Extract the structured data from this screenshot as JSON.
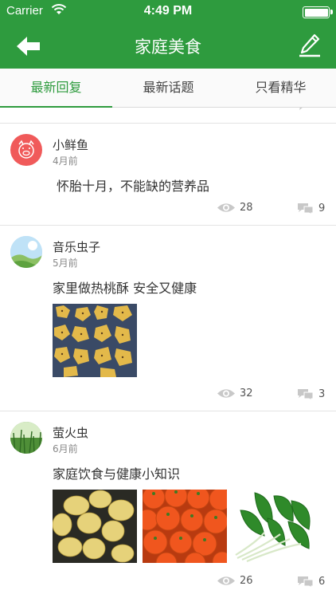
{
  "status": {
    "carrier": "Carrier",
    "time": "4:49 PM"
  },
  "nav": {
    "title": "家庭美食"
  },
  "tabs": [
    {
      "label": "最新回复",
      "active": true
    },
    {
      "label": "最新话题",
      "active": false
    },
    {
      "label": "只看精华",
      "active": false
    }
  ],
  "posts": [
    {
      "user": "小鲜鱼",
      "time": "4月前",
      "title": "怀胎十月，不能缺的营养品",
      "views": "28",
      "comments": "9"
    },
    {
      "user": "音乐虫子",
      "time": "5月前",
      "title": "家里做热桃酥  安全又健康",
      "views": "32",
      "comments": "3"
    },
    {
      "user": "萤火虫",
      "time": "6月前",
      "title": "家庭饮食与健康小知识",
      "views": "26",
      "comments": "6"
    }
  ],
  "colors": {
    "accent": "#2e9b3e",
    "avatar_red": "#f05a5a"
  },
  "icons": [
    "back-arrow-icon",
    "edit-pencil-icon",
    "eye-icon",
    "comment-bubble-icon",
    "wifi-icon",
    "battery-icon"
  ]
}
